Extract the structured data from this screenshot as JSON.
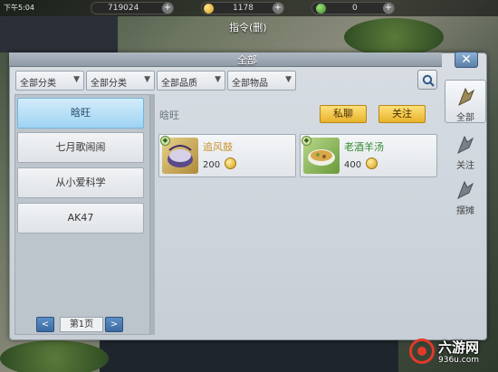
{
  "status_bar": {
    "time": "下午5:04",
    "silver": "719024",
    "gold": "1178",
    "jade": "0"
  },
  "command_label": "指令(删)",
  "panel": {
    "title": "全部",
    "filters": [
      "全部分类",
      "全部分类",
      "全部品质",
      "全部物品"
    ]
  },
  "sellers": [
    {
      "name": "晗旺",
      "selected": true
    },
    {
      "name": "七月歌闹闹",
      "selected": false
    },
    {
      "name": "从小爱科学",
      "selected": false
    },
    {
      "name": "AK47",
      "selected": false
    }
  ],
  "pager": {
    "prev": "<",
    "page": "第1页",
    "next": ">"
  },
  "shop": {
    "seller_name": "晗旺",
    "chat_label": "私聊",
    "follow_label": "关注",
    "goods": [
      {
        "name": "追风鼓",
        "price": "200",
        "name_color": "#c8902a"
      },
      {
        "name": "老酒羊汤",
        "price": "400",
        "name_color": "#2f8a2f"
      }
    ]
  },
  "side_tabs": [
    {
      "label": "全部",
      "icon": "fan-icon",
      "active": true
    },
    {
      "label": "关注",
      "icon": "fan-icon",
      "active": false
    },
    {
      "label": "摆摊",
      "icon": "fan-icon",
      "active": false
    }
  ],
  "watermark": {
    "name": "六游网",
    "url": "936u.com"
  },
  "colors": {
    "accent_blue": "#9fd3f2",
    "button_gold": "#e8b32c"
  }
}
